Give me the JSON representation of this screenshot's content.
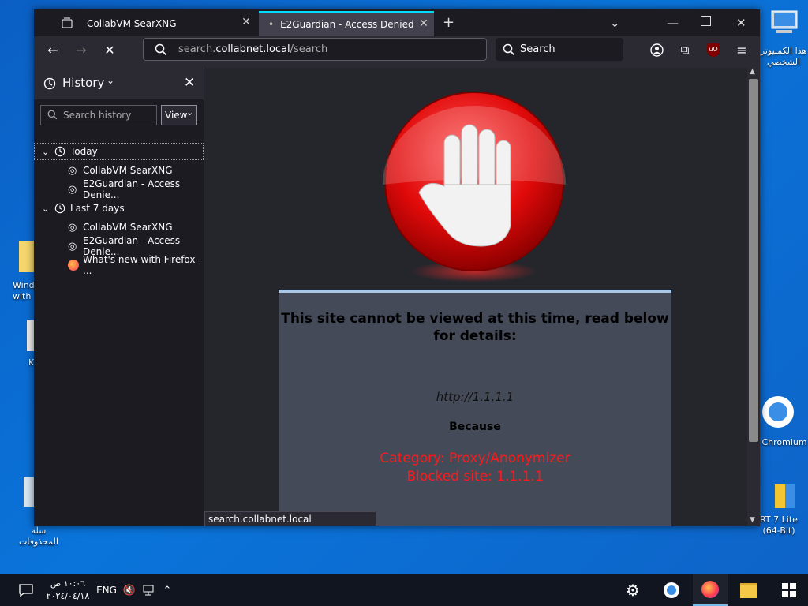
{
  "desktop": {
    "icons": [
      {
        "label": "هذا الكمبيوتر الشخصي"
      },
      {
        "label": "Wind with"
      },
      {
        "label": "K"
      },
      {
        "label": "Chromium"
      },
      {
        "label": "سلة المحذوفات"
      },
      {
        "label": "RT 7 Lite (64-Bit)"
      }
    ]
  },
  "tabs": [
    {
      "title": "CollabVM SearXNG",
      "active": false
    },
    {
      "title": "E2Guardian - Access Denied",
      "active": true
    }
  ],
  "toolbar": {
    "url_prefix": "search.",
    "url_domain": "collabnet.local",
    "url_path": "/search",
    "search_placeholder": "Search"
  },
  "sidebar": {
    "title": "History",
    "search_placeholder": "Search history",
    "view_label": "View",
    "groups": [
      {
        "label": "Today",
        "items": [
          "CollabVM SearXNG",
          "E2Guardian - Access Denie..."
        ]
      },
      {
        "label": "Last 7 days",
        "items": [
          "CollabVM SearXNG",
          "E2Guardian - Access Denie...",
          "What's new with Firefox - ..."
        ]
      }
    ]
  },
  "page": {
    "message": "This site cannot be viewed at this time, read below for details:",
    "blocked_url": "http://1.1.1.1",
    "because": "Because",
    "category": "Category: Proxy/Anonymizer",
    "blocked_site": "Blocked site: 1.1.1.1"
  },
  "status_url": "search.collabnet.local",
  "taskbar": {
    "time": "١٠:٠٦ ص",
    "date": "٢٠٢٤/٠٤/١٨",
    "lang": "ENG"
  },
  "colors": {
    "accent": "#00ddff",
    "blocked_red": "#ff1a1a"
  }
}
